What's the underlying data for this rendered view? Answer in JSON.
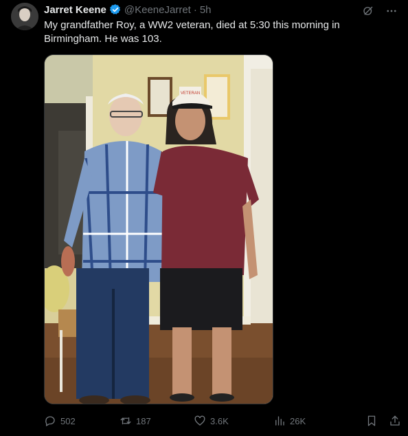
{
  "tweet": {
    "author_name": "Jarret Keene",
    "handle": "@KeeneJarret",
    "separator": "·",
    "time": "5h",
    "text": "My grandfather Roy, a WW2 veteran, died at 5:30 this morning in Birmingham. He was 103."
  },
  "media": {
    "cap_text": "VETERAN"
  },
  "icons": {
    "verified": "verified-badge-icon",
    "grok": "grok-icon",
    "more": "more-icon",
    "reply": "reply-icon",
    "retweet": "retweet-icon",
    "like": "like-icon",
    "views": "views-icon",
    "bookmark": "bookmark-icon",
    "share": "share-icon"
  },
  "stats": {
    "replies": "502",
    "retweets": "187",
    "likes": "3.6K",
    "views": "26K"
  },
  "colors": {
    "background": "#000000",
    "text": "#e7e9ea",
    "muted": "#71767b",
    "verified": "#1d9bf0"
  }
}
